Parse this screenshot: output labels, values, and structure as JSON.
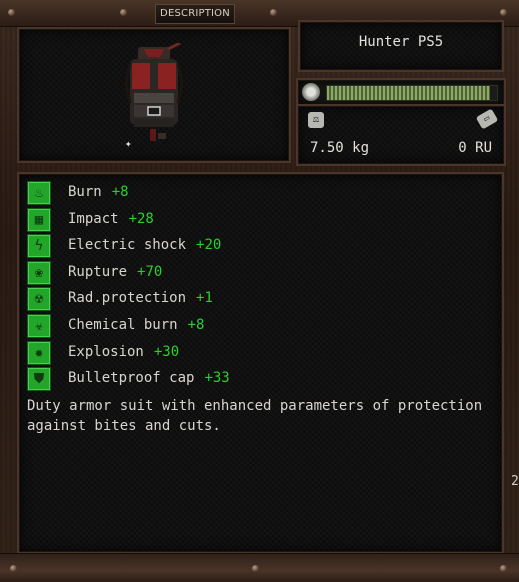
{
  "header": {
    "tab_label": "DESCRIPTION"
  },
  "item": {
    "name": "Hunter PS5",
    "weight": "7.50 kg",
    "price": "0 RU",
    "condition_fraction": 0.96,
    "upgrade_icon": "wrench-icon"
  },
  "resistances": [
    {
      "icon": "burn-icon",
      "label": "Burn",
      "value": "+8"
    },
    {
      "icon": "impact-icon",
      "label": "Impact",
      "value": "+28"
    },
    {
      "icon": "electric-shock-icon",
      "label": "Electric shock",
      "value": "+20"
    },
    {
      "icon": "rupture-icon",
      "label": "Rupture",
      "value": "+70"
    },
    {
      "icon": "radiation-icon",
      "label": "Rad.protection",
      "value": "+1"
    },
    {
      "icon": "biohazard-icon",
      "label": "Chemical burn",
      "value": "+8"
    },
    {
      "icon": "explosion-icon",
      "label": "Explosion",
      "value": "+30"
    },
    {
      "icon": "bulletproof-vest-icon",
      "label": "Bulletproof cap",
      "value": "+33"
    }
  ],
  "description": "Duty armor suit with enhanced parameters of protection against bites and cuts.",
  "edge_text": "2",
  "colors": {
    "accent_green": "#29d12e",
    "icon_green": "#23a52a",
    "text": "#d9d6d1"
  }
}
